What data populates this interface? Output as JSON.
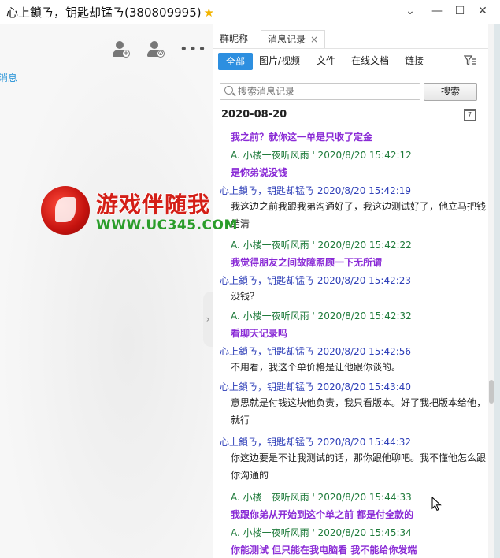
{
  "window": {
    "title": "心上鎖ㄋ，钥匙却锰ㄋ(380809995)",
    "star_icon": "star-icon",
    "controls": [
      "chevron-down-icon",
      "minimize-icon",
      "maximize-icon",
      "close-icon"
    ]
  },
  "left_panel": {
    "link_text": "消息",
    "more_label": "•••"
  },
  "watermark": {
    "title": "游戏伴随我",
    "url": "WWW.UC345.COM"
  },
  "tabs": [
    {
      "label": "群昵称"
    },
    {
      "label": "消息记录",
      "close": "×"
    }
  ],
  "filters": [
    "全部",
    "图片/视频",
    "文件",
    "在线文档",
    "链接"
  ],
  "search": {
    "placeholder": "搜索消息记录",
    "button": "搜索"
  },
  "date_header": "2020-08-20",
  "calendar_icon_label": "7",
  "messages": [
    {
      "type": "purple",
      "text": "我之前？就你这一单是只收了定金"
    },
    {
      "type": "sender-green",
      "text": "A.   小楼一夜听风雨 '  2020/8/20 15:42:12"
    },
    {
      "type": "purple",
      "text": "是你弟说没钱"
    },
    {
      "type": "sender",
      "text": "心上鎖ㄋ，钥匙却锰ㄋ 2020/8/20 15:42:19"
    },
    {
      "type": "text",
      "text": "我这边之前我跟我弟沟通好了，我这边测试好了，他立马把钱结清"
    },
    {
      "type": "sender-green",
      "text": "A.   小楼一夜听风雨 '  2020/8/20 15:42:22"
    },
    {
      "type": "purple",
      "text": "我觉得朋友之间故障照顾一下无所谓"
    },
    {
      "type": "sender",
      "text": "心上鎖ㄋ，钥匙却锰ㄋ 2020/8/20 15:42:23"
    },
    {
      "type": "text",
      "text": "没钱？"
    },
    {
      "type": "sender-green",
      "text": "A.   小楼一夜听风雨 '  2020/8/20 15:42:32"
    },
    {
      "type": "purple",
      "text": "看聊天记录吗"
    },
    {
      "type": "sender",
      "text": "心上鎖ㄋ，钥匙却锰ㄋ 2020/8/20 15:42:56"
    },
    {
      "type": "text",
      "text": "不用看，我这个单价格是让他跟你谈的。"
    },
    {
      "type": "sender",
      "text": "心上鎖ㄋ，钥匙却锰ㄋ 2020/8/20 15:43:40"
    },
    {
      "type": "text",
      "text": "意思就是付钱这块他负责，我只看版本。好了我把版本给他，就行"
    },
    {
      "type": "sender",
      "text": "心上鎖ㄋ，钥匙却锰ㄋ 2020/8/20 15:44:32"
    },
    {
      "type": "text",
      "text": "你这边要是不让我测试的话，那你跟他聊吧。我不懂他怎么跟你沟通的"
    },
    {
      "type": "sender-green",
      "text": "A.   小楼一夜听风雨 '  2020/8/20 15:44:33"
    },
    {
      "type": "purple",
      "text": "我跟你弟从开始到这个单之前 都是付全款的"
    },
    {
      "type": "sender-green",
      "text": "A.   小楼一夜听风雨 '  2020/8/20 15:45:34"
    },
    {
      "type": "purple",
      "text": "你能测试 但只能在我电脑看   我不能给你发端"
    }
  ]
}
